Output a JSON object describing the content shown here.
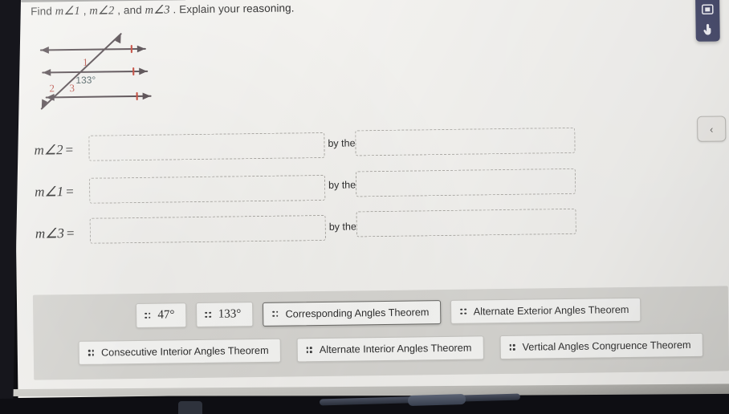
{
  "question": {
    "prefix": "Find ",
    "m1": "m∠1",
    "sep1": " , ",
    "m2": "m∠2",
    "sep2": " ,  and ",
    "m3": "m∠3",
    "suffix": " . Explain your reasoning."
  },
  "figure": {
    "angle_label": "133°",
    "label_1": "1",
    "label_2": "2",
    "label_3": "3",
    "line_color": "#4a3f44",
    "tick_color": "#c0392b",
    "label_color": "#b5453c",
    "angle_label_color": "#3f5356",
    "description": "three parallel lines cut by a transversal"
  },
  "rows": [
    {
      "label": "m∠2",
      "equals": "=",
      "answer": "",
      "connector": "by the",
      "reason": ""
    },
    {
      "label": "m∠1",
      "equals": "=",
      "answer": "",
      "connector": "by the",
      "reason": ""
    },
    {
      "label": "m∠3",
      "equals": "=",
      "answer": "",
      "connector": "by the",
      "reason": ""
    }
  ],
  "answer_bank": {
    "row1": [
      {
        "label": "47°",
        "kind": "number",
        "selected": false
      },
      {
        "label": "133°",
        "kind": "number",
        "selected": false
      },
      {
        "label": "Corresponding Angles Theorem",
        "kind": "theorem",
        "selected": true
      },
      {
        "label": "Alternate Exterior Angles Theorem",
        "kind": "theorem",
        "selected": false
      }
    ],
    "row2": [
      {
        "label": "Consecutive Interior Angles Theorem",
        "kind": "theorem",
        "selected": false
      },
      {
        "label": "Alternate Interior Angles Theorem",
        "kind": "theorem",
        "selected": false
      },
      {
        "label": "Vertical Angles Congruence Theorem",
        "kind": "theorem",
        "selected": false
      }
    ]
  },
  "chrome": {
    "toolbar_icons": [
      "bookmark-icon",
      "screenshot-icon",
      "pointer-icon"
    ],
    "back_button_glyph": "‹",
    "toolbar_color": "#2b2f55"
  }
}
